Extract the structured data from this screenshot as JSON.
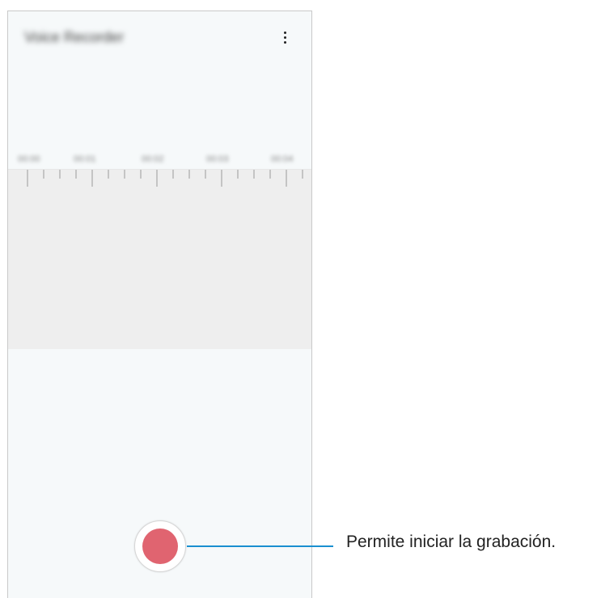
{
  "app": {
    "title": "Voice Recorder"
  },
  "timeline": {
    "labels": [
      "00:00",
      "00:01",
      "00:02",
      "00:03",
      "00:04"
    ]
  },
  "controls": {
    "more_icon": "more-vertical-icon",
    "record_icon": "record-icon"
  },
  "annotation": {
    "text": "Permite iniciar la grabación."
  },
  "colors": {
    "record": "#e06470",
    "callout_line": "#1a8fd0",
    "wave_background": "#eeeeee",
    "screen_background": "#f6f9fa"
  }
}
